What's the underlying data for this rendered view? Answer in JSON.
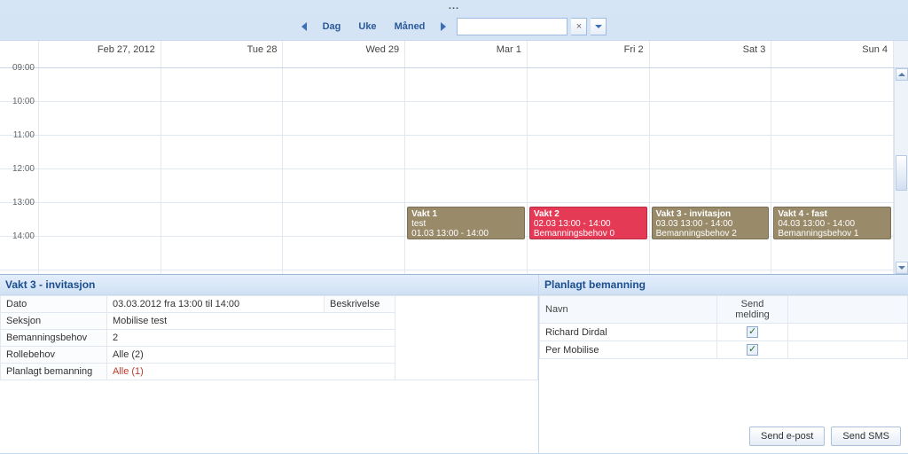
{
  "top_ellipsis": "...",
  "nav": {
    "day": "Dag",
    "week": "Uke",
    "month": "Måned",
    "search_value": "",
    "search_placeholder": ""
  },
  "days": [
    "Feb 27, 2012",
    "Tue 28",
    "Wed 29",
    "Mar 1",
    "Fri 2",
    "Sat 3",
    "Sun 4"
  ],
  "times": [
    "09:00",
    "10:00",
    "11:00",
    "12:00",
    "13:00",
    "14:00"
  ],
  "events": [
    {
      "col": 3,
      "class": "ev-brown",
      "title": "Vakt 1",
      "sub": "test",
      "time": "01.03 13:00 - 14:00"
    },
    {
      "col": 4,
      "class": "ev-red",
      "title": "Vakt 2",
      "sub": "02.03 13:00 - 14:00",
      "time": "Bemanningsbehov 0"
    },
    {
      "col": 5,
      "class": "ev-brown",
      "title": "Vakt 3 - invitasjon",
      "sub": "03.03 13:00 - 14:00",
      "time": "Bemanningsbehov 2"
    },
    {
      "col": 6,
      "class": "ev-brown",
      "title": "Vakt 4 - fast",
      "sub": "04.03 13:00 - 14:00",
      "time": "Bemanningsbehov 1"
    }
  ],
  "detail": {
    "title": "Vakt 3 - invitasjon",
    "labels": {
      "dato": "Dato",
      "seksjon": "Seksjon",
      "bemanningsbehov": "Bemanningsbehov",
      "rollebehov": "Rollebehov",
      "planlagt": "Planlagt bemanning",
      "beskrivelse": "Beskrivelse"
    },
    "values": {
      "dato": "03.03.2012 fra 13:00 til 14:00",
      "seksjon": "Mobilise test",
      "bemanningsbehov": "2",
      "rollebehov": "Alle (2)",
      "planlagt": "Alle (1)",
      "beskrivelse": ""
    }
  },
  "staffing": {
    "title": "Planlagt bemanning",
    "col_name": "Navn",
    "col_send": "Send melding",
    "rows": [
      {
        "name": "Richard Dirdal",
        "checked": true
      },
      {
        "name": "Per Mobilise",
        "checked": true
      }
    ]
  },
  "buttons": {
    "email": "Send e-post",
    "sms": "Send SMS"
  }
}
